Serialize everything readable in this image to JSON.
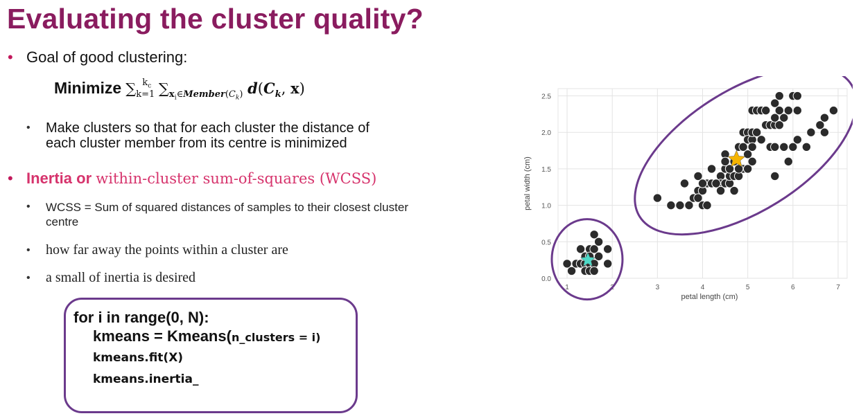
{
  "title": "Evaluating the cluster quality?",
  "bullets": {
    "goal": "Goal of good clustering:",
    "formula_word": "Minimize",
    "formula_math": "∑k=1..kc ∑xᵢ∈Member(Cₖ) d(Cₖ, x)",
    "make_clusters": "Make clusters so that for each cluster the distance of each cluster member from its centre is minimized",
    "inertia_label": "Inertia or",
    "inertia_rest": "within-cluster sum-of-squares (WCSS)",
    "wcss_def": "WCSS = Sum of squared distances of samples to their closest cluster centre",
    "how_far": "how far away the points within a cluster are",
    "small_inertia": "a small of inertia is desired"
  },
  "code": {
    "line1": "for i in range(0, N):",
    "line2_a": "kmeans = Kmeans(",
    "line2_b": "n_clusters = i)",
    "line3": "kmeans.fit(X)",
    "line4": "kmeans.inertia_"
  },
  "chart_data": {
    "type": "scatter",
    "xlabel": "petal length (cm)",
    "ylabel": "petal width (cm)",
    "xlim": [
      0.8,
      7.2
    ],
    "ylim": [
      0.0,
      2.6
    ],
    "xticks": [
      1,
      2,
      3,
      4,
      5,
      6,
      7
    ],
    "yticks": [
      0.0,
      0.5,
      1.0,
      1.5,
      2.0,
      2.5
    ],
    "grid": true,
    "point_color": "#2b2b2b",
    "points": [
      [
        1.0,
        0.2
      ],
      [
        1.1,
        0.1
      ],
      [
        1.2,
        0.2
      ],
      [
        1.3,
        0.2
      ],
      [
        1.3,
        0.4
      ],
      [
        1.4,
        0.2
      ],
      [
        1.4,
        0.1
      ],
      [
        1.4,
        0.3
      ],
      [
        1.5,
        0.2
      ],
      [
        1.5,
        0.4
      ],
      [
        1.5,
        0.1
      ],
      [
        1.6,
        0.2
      ],
      [
        1.6,
        0.4
      ],
      [
        1.6,
        0.6
      ],
      [
        1.7,
        0.3
      ],
      [
        1.7,
        0.5
      ],
      [
        1.9,
        0.2
      ],
      [
        1.9,
        0.4
      ],
      [
        1.5,
        0.3
      ],
      [
        1.6,
        0.1
      ],
      [
        3.0,
        1.1
      ],
      [
        3.3,
        1.0
      ],
      [
        3.5,
        1.0
      ],
      [
        3.6,
        1.3
      ],
      [
        3.7,
        1.0
      ],
      [
        3.8,
        1.1
      ],
      [
        3.9,
        1.2
      ],
      [
        3.9,
        1.4
      ],
      [
        3.9,
        1.1
      ],
      [
        4.0,
        1.0
      ],
      [
        4.0,
        1.3
      ],
      [
        4.0,
        1.2
      ],
      [
        4.1,
        1.3
      ],
      [
        4.1,
        1.0
      ],
      [
        4.2,
        1.3
      ],
      [
        4.2,
        1.5
      ],
      [
        4.3,
        1.3
      ],
      [
        4.4,
        1.4
      ],
      [
        4.4,
        1.3
      ],
      [
        4.4,
        1.2
      ],
      [
        4.5,
        1.5
      ],
      [
        4.5,
        1.3
      ],
      [
        4.5,
        1.7
      ],
      [
        4.6,
        1.3
      ],
      [
        4.6,
        1.4
      ],
      [
        4.6,
        1.5
      ],
      [
        4.7,
        1.4
      ],
      [
        4.7,
        1.2
      ],
      [
        4.7,
        1.6
      ],
      [
        4.8,
        1.8
      ],
      [
        4.8,
        1.4
      ],
      [
        4.9,
        1.5
      ],
      [
        4.9,
        1.8
      ],
      [
        4.9,
        2.0
      ],
      [
        5.0,
        1.7
      ],
      [
        5.0,
        1.5
      ],
      [
        5.0,
        2.0
      ],
      [
        5.0,
        1.9
      ],
      [
        5.1,
        1.6
      ],
      [
        5.1,
        1.9
      ],
      [
        5.1,
        2.0
      ],
      [
        5.1,
        2.3
      ],
      [
        5.1,
        1.8
      ],
      [
        5.2,
        2.3
      ],
      [
        5.2,
        2.0
      ],
      [
        5.3,
        1.9
      ],
      [
        5.3,
        2.3
      ],
      [
        5.4,
        2.1
      ],
      [
        5.4,
        2.3
      ],
      [
        5.5,
        1.8
      ],
      [
        5.5,
        2.1
      ],
      [
        5.6,
        1.8
      ],
      [
        5.6,
        2.1
      ],
      [
        5.6,
        2.2
      ],
      [
        5.6,
        2.4
      ],
      [
        5.6,
        1.4
      ],
      [
        5.7,
        2.5
      ],
      [
        5.7,
        2.1
      ],
      [
        5.7,
        2.3
      ],
      [
        5.8,
        1.8
      ],
      [
        5.8,
        2.2
      ],
      [
        5.9,
        2.3
      ],
      [
        5.9,
        1.6
      ],
      [
        6.0,
        1.8
      ],
      [
        6.0,
        2.5
      ],
      [
        6.1,
        1.9
      ],
      [
        6.1,
        2.3
      ],
      [
        6.1,
        2.5
      ],
      [
        6.3,
        1.8
      ],
      [
        6.4,
        2.0
      ],
      [
        6.6,
        2.1
      ],
      [
        6.7,
        2.2
      ],
      [
        6.7,
        2.0
      ],
      [
        6.9,
        2.3
      ],
      [
        4.6,
        1.5
      ],
      [
        4.5,
        1.6
      ],
      [
        5.0,
        1.5
      ],
      [
        4.3,
        1.3
      ],
      [
        4.8,
        1.5
      ],
      [
        4.0,
        1.3
      ]
    ],
    "centroids": [
      {
        "x": 1.46,
        "y": 0.25,
        "color": "#4dd9c7"
      },
      {
        "x": 4.75,
        "y": 1.63,
        "color": "#f5b400"
      }
    ],
    "highlight_color": "#6b3a8c"
  }
}
